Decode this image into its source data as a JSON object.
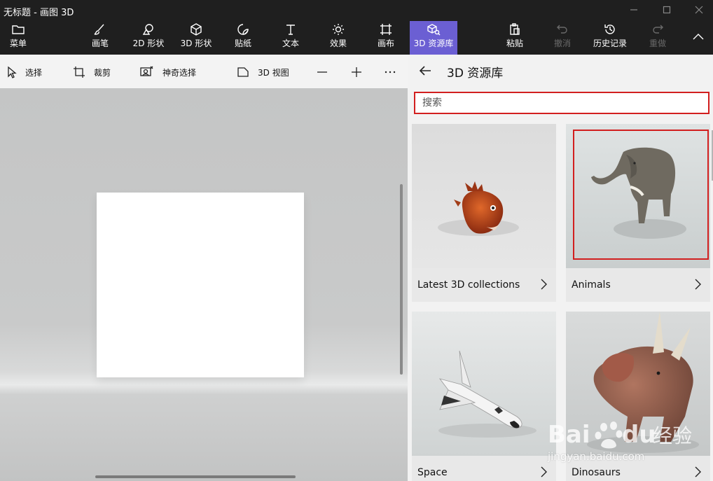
{
  "window": {
    "title": "无标题 - 画图 3D",
    "controls": [
      "minimize-icon",
      "maximize-icon",
      "close-icon"
    ]
  },
  "ribbon": {
    "menu": {
      "label": "菜单",
      "icon": "folder-icon"
    },
    "tools": [
      {
        "label": "画笔",
        "icon": "brush-icon"
      },
      {
        "label": "2D 形状",
        "icon": "2d-shapes-icon"
      },
      {
        "label": "3D 形状",
        "icon": "3d-cube-icon"
      },
      {
        "label": "贴纸",
        "icon": "sticker-icon"
      },
      {
        "label": "文本",
        "icon": "text-icon"
      },
      {
        "label": "效果",
        "icon": "sun-icon"
      },
      {
        "label": "画布",
        "icon": "canvas-icon"
      },
      {
        "label": "3D 资源库",
        "icon": "3d-library-icon",
        "active": true
      }
    ],
    "actions": [
      {
        "label": "粘贴",
        "icon": "paste-icon",
        "enabled": true
      },
      {
        "label": "撤消",
        "icon": "undo-icon",
        "enabled": false
      },
      {
        "label": "历史记录",
        "icon": "history-icon",
        "enabled": true
      },
      {
        "label": "重做",
        "icon": "redo-icon",
        "enabled": false
      }
    ],
    "collapse_icon": "chevron-up-icon",
    "active_color": "#6b5fd3"
  },
  "toolbar": {
    "select": "选择",
    "crop": "裁剪",
    "magic_select": "神奇选择",
    "view_3d": "3D 视图"
  },
  "library": {
    "title": "3D 资源库",
    "search_placeholder": "搜索",
    "categories": [
      {
        "label": "Latest 3D collections",
        "thumb": "anglerfish"
      },
      {
        "label": "Animals",
        "thumb": "elephant",
        "highlighted": true
      },
      {
        "label": "Space",
        "thumb": "space-shuttle"
      },
      {
        "label": "Dinosaurs",
        "thumb": "triceratops"
      }
    ],
    "highlight_color": "#d21f1f"
  },
  "watermark": {
    "text": "jingyan.baidu.com"
  }
}
